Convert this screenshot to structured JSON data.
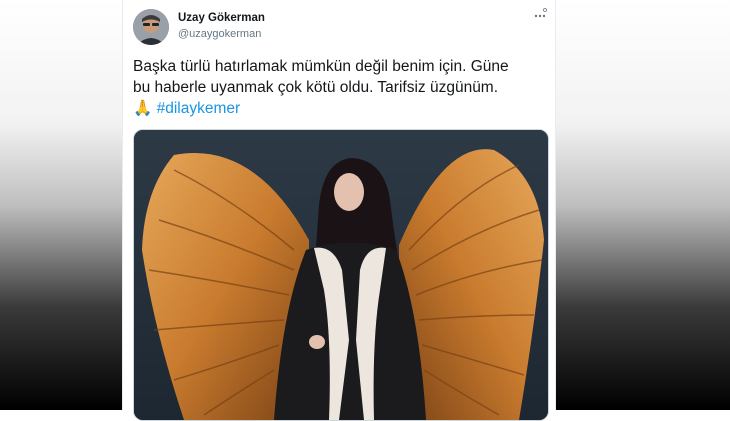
{
  "tweet": {
    "author_name": "Uzay Gökerman",
    "author_handle": "@uzaygokerman",
    "more_icon": "ellipsis-icon",
    "text_line1": "Başka türlü hatırlamak mümkün değil benim için. Güne",
    "text_line2": "bu haberle uyanmak çok kötü oldu. Tarifsiz üzgünüm.",
    "emoji": "🙏",
    "hashtag": "#dilaykemer",
    "colors": {
      "link": "#1b95e0",
      "text": "#14171a",
      "secondary": "#657786"
    }
  }
}
